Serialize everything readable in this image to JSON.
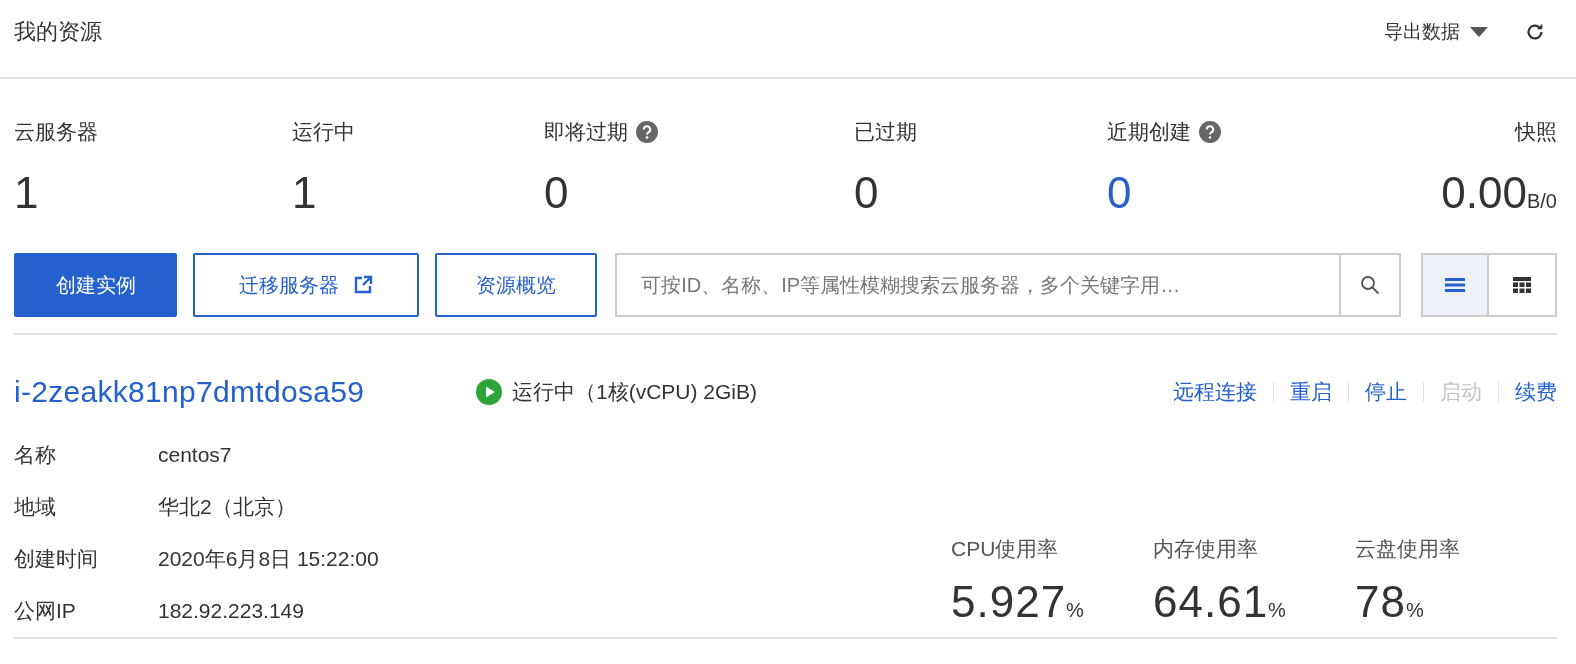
{
  "header": {
    "title": "我的资源",
    "export_label": "导出数据"
  },
  "stats": [
    {
      "label": "云服务器",
      "value": "1",
      "help": false,
      "highlight": false
    },
    {
      "label": "运行中",
      "value": "1",
      "help": false,
      "highlight": false
    },
    {
      "label": "即将过期",
      "value": "0",
      "help": true,
      "highlight": false
    },
    {
      "label": "已过期",
      "value": "0",
      "help": false,
      "highlight": false
    },
    {
      "label": "近期创建",
      "value": "0",
      "help": true,
      "highlight": true
    },
    {
      "label": "快照",
      "value": "0.00",
      "unit": "B/0",
      "help": false,
      "highlight": false
    }
  ],
  "toolbar": {
    "buttons": [
      {
        "label": "创建实例",
        "kind": "primary"
      },
      {
        "label": "迁移服务器",
        "kind": "external"
      },
      {
        "label": "资源概览",
        "kind": "outline"
      }
    ],
    "search": {
      "placeholder": "可按ID、名称、IP等属性模糊搜索云服务器，多个关键字用…"
    },
    "views": [
      {
        "kind": "list",
        "selected": true
      },
      {
        "kind": "grid",
        "selected": false
      }
    ]
  },
  "instance": {
    "id": "i-2zeakk81np7dmtdosa59",
    "running": true,
    "status": "运行中（1核(vCPU) 2GiB)",
    "actions": [
      {
        "label": "远程连接",
        "disabled": false
      },
      {
        "label": "重启",
        "disabled": false
      },
      {
        "label": "停止",
        "disabled": false
      },
      {
        "label": "启动",
        "disabled": true
      },
      {
        "label": "续费",
        "disabled": false
      }
    ],
    "details": [
      {
        "label": "名称",
        "value": "centos7"
      },
      {
        "label": "地域",
        "value": "华北2（北京）"
      },
      {
        "label": "创建时间",
        "value": "2020年6月8日 15:22:00"
      },
      {
        "label": "公网IP",
        "value": "182.92.223.149"
      }
    ],
    "metrics": [
      {
        "label": "CPU使用率",
        "value": "5.927",
        "unit": "%"
      },
      {
        "label": "内存使用率",
        "value": "64.61",
        "unit": "%"
      },
      {
        "label": "云盘使用率",
        "value": "78",
        "unit": "%"
      }
    ]
  }
}
